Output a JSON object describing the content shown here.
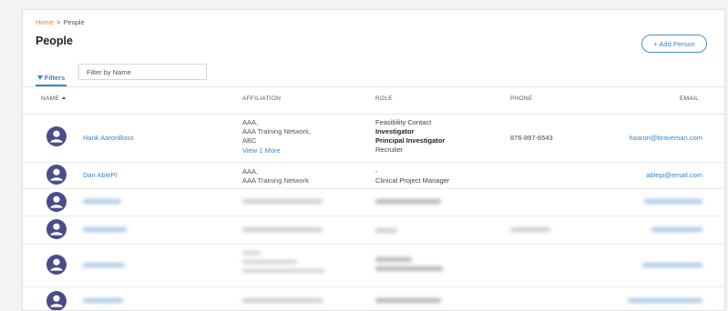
{
  "breadcrumb": {
    "home": "Home",
    "separator": ">",
    "current": "People"
  },
  "page_title": "People",
  "add_person_button": "+ Add Person",
  "filters": {
    "tab_label": "Filters",
    "name_placeholder": "Filter by Name"
  },
  "table": {
    "headers": {
      "name": "NAME",
      "affiliation": "AFFILIATION",
      "role": "ROLE",
      "phone": "PHONE",
      "email": "EMAIL"
    },
    "rows": [
      {
        "name": "Hank AaronBoss",
        "affiliation": [
          "AAA,",
          "AAA Training Network,",
          "ABC"
        ],
        "view_more": "View 1 More",
        "roles": [
          "Feasibility Contact",
          "Investigator",
          "Principal Investigator",
          "Recruiter"
        ],
        "phone": "876-897-6543",
        "email": "haaron@braveman.com"
      },
      {
        "name": "Dan AblePI",
        "affiliation": [
          "AAA,",
          "AAA Training Network"
        ],
        "roles": [
          "-",
          "Clinical Project Manager"
        ],
        "phone": "",
        "email": "ablepi@email.com"
      }
    ]
  },
  "colors": {
    "accent": "#3a85c5",
    "breadcrumb_home": "#e6823a",
    "avatar": "#4c4c8c"
  },
  "icons": {
    "avatar": "user-avatar-icon",
    "filter": "funnel-icon",
    "sort": "sort-ascending-icon"
  }
}
